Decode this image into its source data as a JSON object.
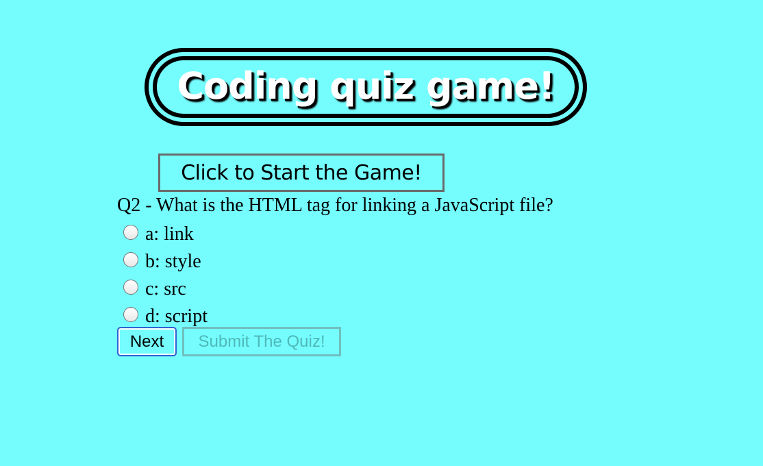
{
  "colors": {
    "background": "#75fcfd",
    "title_text": "#ffffff",
    "title_border": "#000000",
    "next_focus_ring": "#2d63d3",
    "submit_disabled_text": "#4fb9b9"
  },
  "header": {
    "title": "Coding quiz game!"
  },
  "start": {
    "label": "Click to Start the Game!"
  },
  "quiz": {
    "question": "Q2 - What is the HTML tag for linking a JavaScript file?",
    "choices": [
      {
        "label": "a: link",
        "selected": false
      },
      {
        "label": "b: style",
        "selected": false
      },
      {
        "label": "c: src",
        "selected": false
      },
      {
        "label": "d: script",
        "selected": false
      }
    ],
    "next_label": "Next",
    "submit_label": "Submit The Quiz!",
    "submit_disabled": true
  }
}
